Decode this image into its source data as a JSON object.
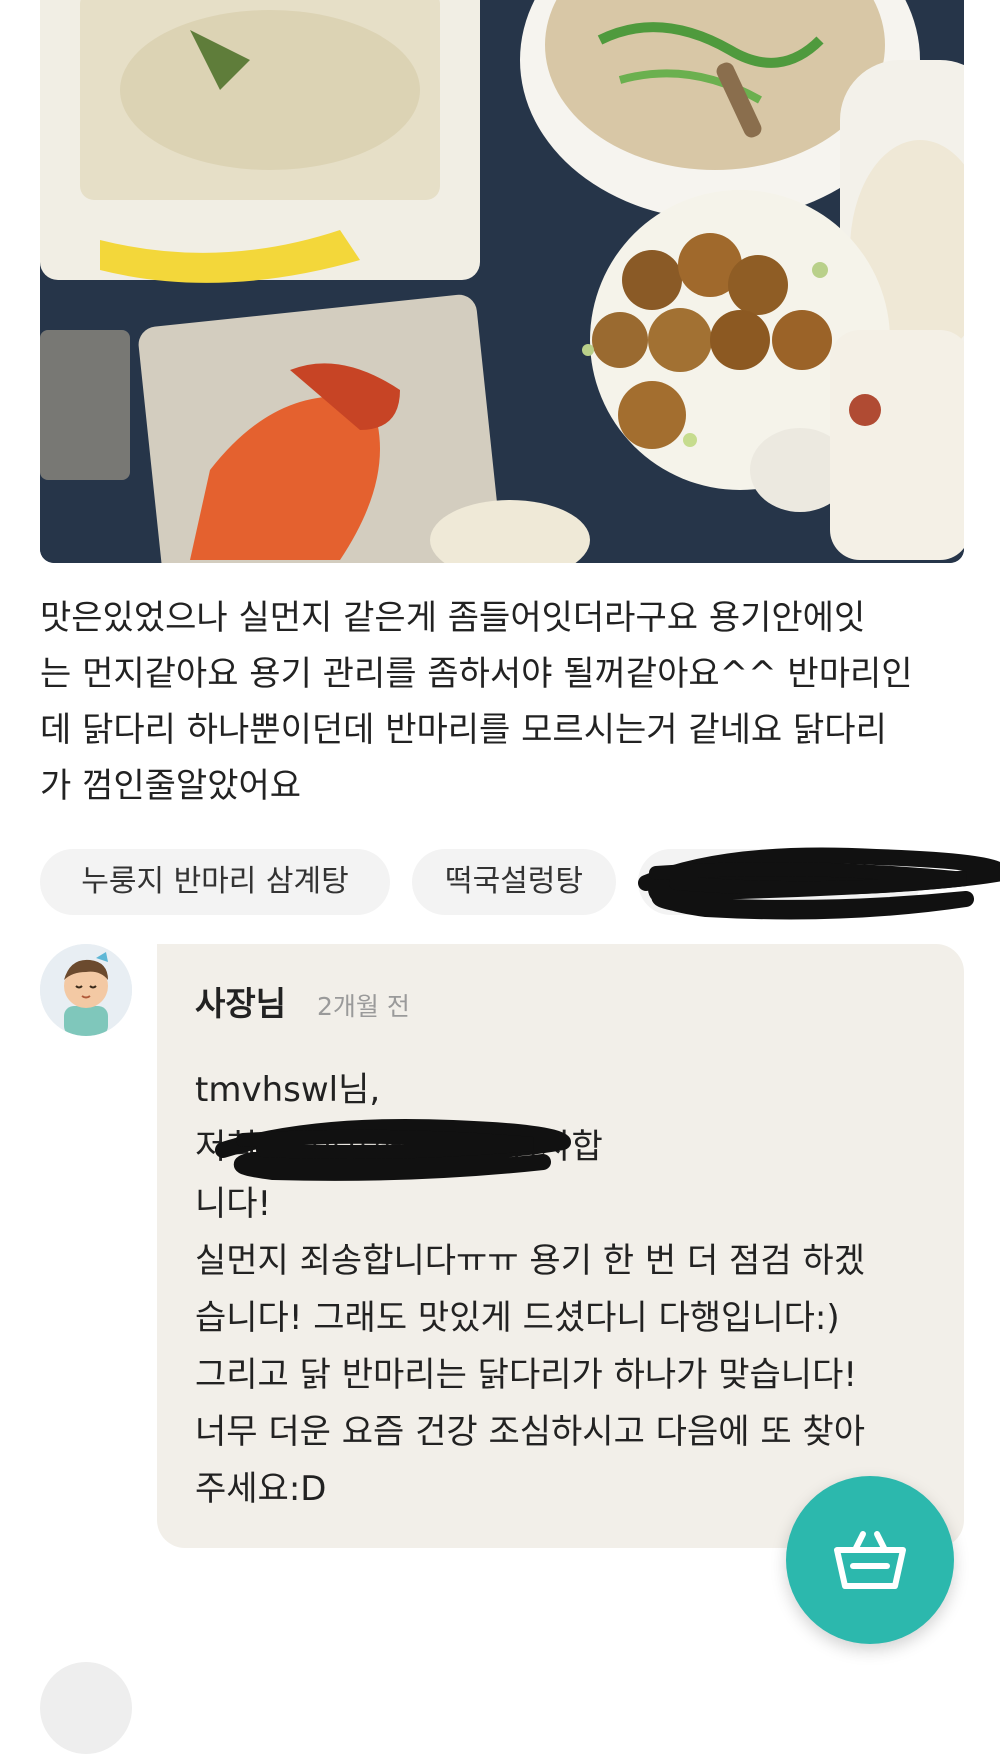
{
  "review": {
    "text": "맛은있었으나 실먼지 같은게 좀들어잇더라구요 용기안에잇\n는 먼지같아요 용기 관리를 좀하서야 될꺼같아요^^ 반마리인\n데 닭다리 하나뿐이던데 반마리를 모르시는거 같네요 닭다리\n가 껌인줄알았어요",
    "menu_tags": [
      "누룽지 반마리 삼계탕",
      "떡국설렁탕",
      ""
    ]
  },
  "owner_reply": {
    "name": "사장님",
    "time": "2개월 전",
    "body": "tmvhswl님,\n저희                  을 이용해주셔서 감사합\n니다!\n실먼지 죄송합니다ㅠㅠ 용기 한 번 더 점검 하겠\n습니다! 그래도 맛있게 드셨다니 다행입니다:)\n그리고 닭 반마리는 닭다리가 하나가 맞습니다!\n너무 더운 요즘 건강 조심하시고 다음에 또 찾아\n주세요:D"
  },
  "icons": {
    "cart": "shopping-basket-icon",
    "avatar": "owner-avatar"
  },
  "colors": {
    "accent": "#2cb8ad",
    "reply_bg": "#f2efe9",
    "tag_bg": "#f3f3f3"
  }
}
